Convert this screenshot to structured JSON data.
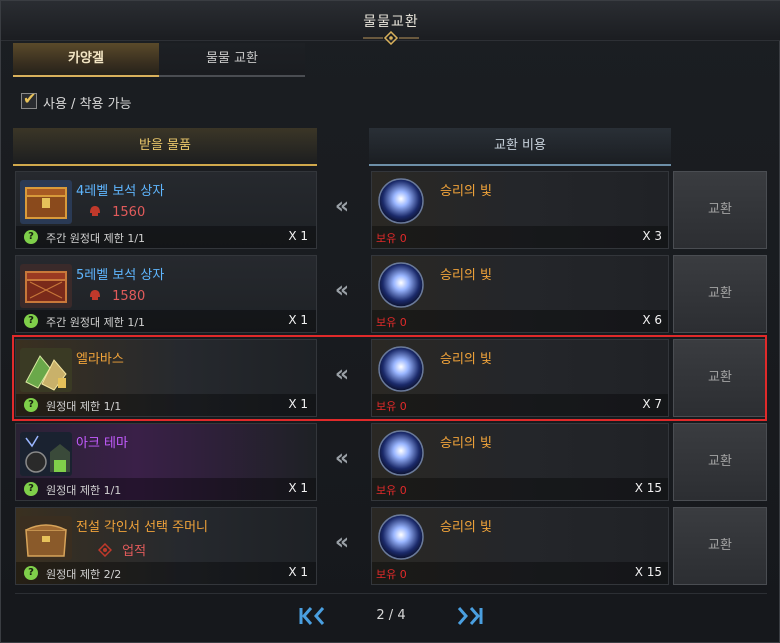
{
  "window": {
    "title": "물물교환"
  },
  "tabs": [
    {
      "label": "카양겔",
      "active": true
    },
    {
      "label": "물물 교환",
      "active": false
    }
  ],
  "filter": {
    "label": "사용 / 착용 가능",
    "checked": true
  },
  "columns": {
    "receive": "받을 물품",
    "cost": "교환 비용"
  },
  "rows": [
    {
      "item_name": "4레벨 보석 상자",
      "item_name_color": "#5fb6ff",
      "item_sub": "1560",
      "item_sub_icon": "helmet-icon",
      "limit": "주간 원정대 제한 1/1",
      "qty": "X 1",
      "cost_name": "승리의 빛",
      "owned": "보유 0",
      "cost_qty": "X 3",
      "button": "교환",
      "highlight": false,
      "item_icon": "treasure-chest-icon"
    },
    {
      "item_name": "5레벨 보석 상자",
      "item_name_color": "#5fb6ff",
      "item_sub": "1580",
      "item_sub_icon": "helmet-icon",
      "limit": "주간 원정대 제한 1/1",
      "qty": "X 1",
      "cost_name": "승리의 빛",
      "owned": "보유 0",
      "cost_qty": "X 6",
      "button": "교환",
      "highlight": false,
      "item_icon": "treasure-chest-icon"
    },
    {
      "item_name": "엘라바스",
      "item_name_color": "#f0a33a",
      "item_sub": "",
      "item_sub_icon": "",
      "limit": "원정대 제한 1/1",
      "qty": "X 1",
      "cost_name": "승리의 빛",
      "owned": "보유 0",
      "cost_qty": "X 7",
      "button": "교환",
      "highlight": true,
      "item_icon": "crystal-shards-icon"
    },
    {
      "item_name": "아크 테마",
      "item_name_color": "#c45cff",
      "item_sub": "",
      "item_sub_icon": "",
      "limit": "원정대 제한 1/1",
      "qty": "X 1",
      "cost_name": "승리의 빛",
      "owned": "보유 0",
      "cost_qty": "X 15",
      "button": "교환",
      "highlight": false,
      "item_icon": "theme-scene-icon"
    },
    {
      "item_name": "전설 각인서 선택 주머니",
      "item_name_color": "#f0a33a",
      "item_sub": "업적",
      "item_sub_icon": "achievement-icon",
      "limit": "원정대 제한 2/2",
      "qty": "X 1",
      "cost_name": "승리의 빛",
      "owned": "보유 0",
      "cost_qty": "X 15",
      "button": "교환",
      "highlight": false,
      "item_icon": "leather-pouch-icon"
    }
  ],
  "pager": {
    "text": "2 / 4",
    "first_icon": "double-chevron-left-icon",
    "last_icon": "double-chevron-right-icon"
  },
  "cost_icon": "light-of-victory-orb-icon",
  "colors": {
    "accent_gold": "#d9b15c",
    "highlight_red": "#e02a2a",
    "owned_red": "#e02a2a",
    "nav_blue": "#4a9fe0"
  }
}
